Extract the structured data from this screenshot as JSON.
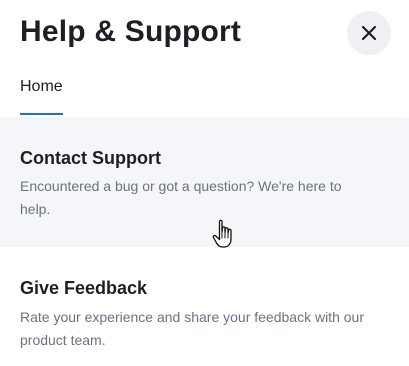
{
  "header": {
    "title": "Help & Support",
    "close_icon": "close-icon"
  },
  "tabs": [
    {
      "label": "Home",
      "active": true
    }
  ],
  "cards": [
    {
      "title": "Contact Support",
      "description": "Encountered a bug or got a question? We're here to help.",
      "hovered": true
    },
    {
      "title": "Give Feedback",
      "description": "Rate your experience and share your feedback with our product team.",
      "hovered": false
    }
  ],
  "colors": {
    "accent": "#1a73c9",
    "hover_bg": "#f4f6fa",
    "close_bg": "#eef0f4",
    "title_text": "#1c1f26",
    "muted_text": "#6b7280"
  },
  "cursor": {
    "icon": "hand-pointer-icon"
  }
}
